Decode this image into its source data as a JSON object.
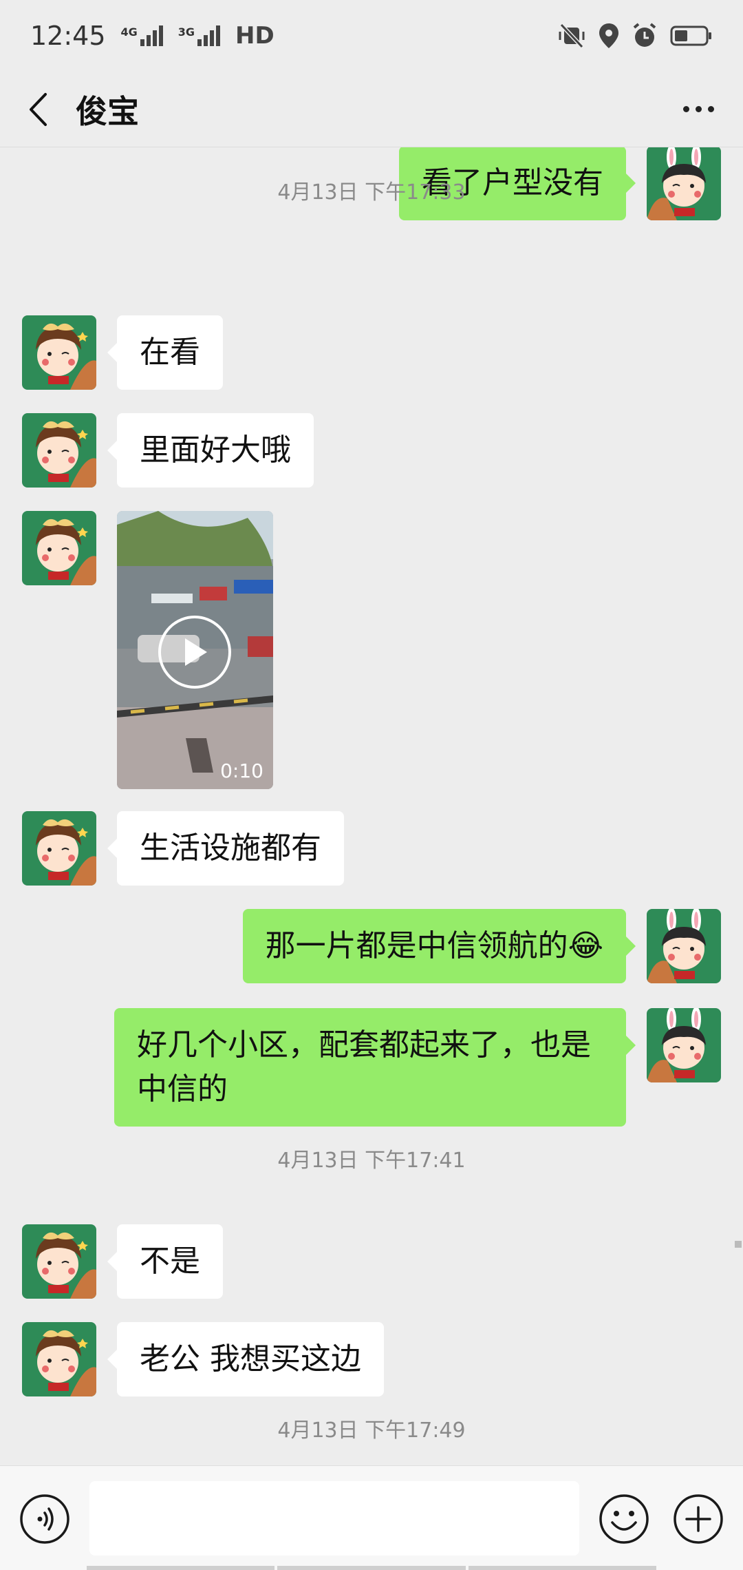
{
  "status_bar": {
    "time": "12:45",
    "network_1": "4G",
    "network_2": "3G",
    "hd": "HD"
  },
  "header": {
    "title": "俊宝",
    "back_icon": "chevron-left-icon",
    "more_icon": "more-dots-icon"
  },
  "messages": [
    {
      "type": "text",
      "side": "right",
      "text": "看了户型没有"
    },
    {
      "type": "timestamp",
      "text": "4月13日 下午17:33"
    },
    {
      "type": "text",
      "side": "left",
      "text": "在看"
    },
    {
      "type": "text",
      "side": "left",
      "text": "里面好大哦"
    },
    {
      "type": "video",
      "side": "left",
      "duration": "0:10"
    },
    {
      "type": "text",
      "side": "left",
      "text": "生活设施都有"
    },
    {
      "type": "text",
      "side": "right",
      "text": "那一片都是中信领航的😂"
    },
    {
      "type": "text",
      "side": "right",
      "text": "好几个小区，配套都起来了，也是中信的"
    },
    {
      "type": "timestamp",
      "text": "4月13日 下午17:41"
    },
    {
      "type": "text",
      "side": "left",
      "text": "不是"
    },
    {
      "type": "text",
      "side": "left",
      "text": "老公 我想买这边"
    },
    {
      "type": "timestamp",
      "text": "4月13日 下午17:49"
    }
  ],
  "input_bar": {
    "voice_icon": "voice-icon",
    "emoji_icon": "emoji-icon",
    "plus_icon": "plus-icon",
    "placeholder": ""
  },
  "colors": {
    "background": "#ededed",
    "sent_bubble": "#95ec69",
    "received_bubble": "#ffffff",
    "avatar_green": "#2e8b57"
  }
}
